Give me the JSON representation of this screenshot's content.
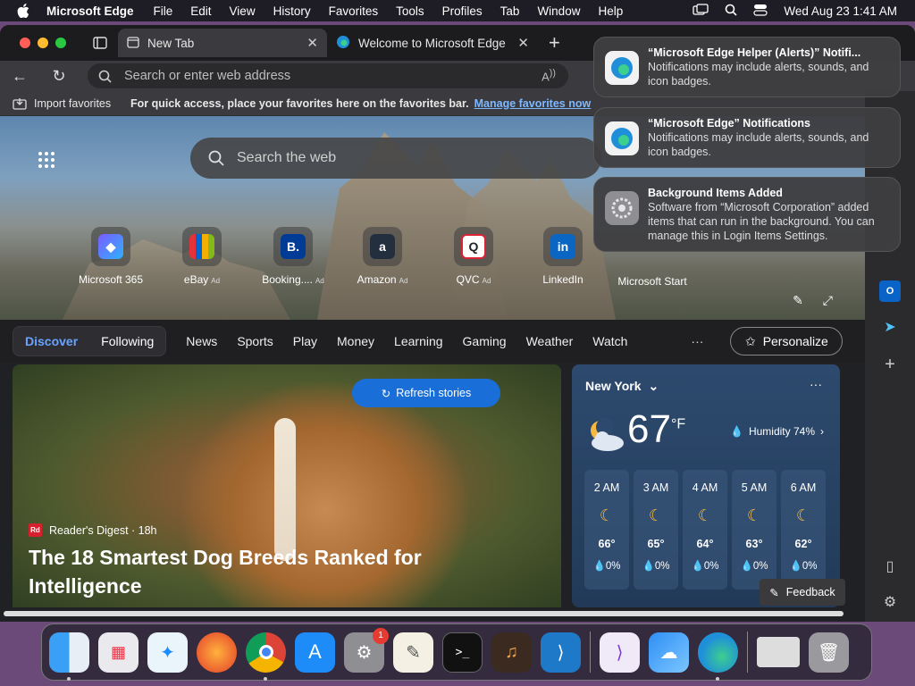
{
  "menubar": {
    "app": "Microsoft Edge",
    "items": [
      "File",
      "Edit",
      "View",
      "History",
      "Favorites",
      "Tools",
      "Profiles",
      "Tab",
      "Window",
      "Help"
    ],
    "clock": "Wed Aug 23  1:41 AM"
  },
  "tabs": [
    {
      "label": "New Tab"
    },
    {
      "label": "Welcome to Microsoft Edge"
    }
  ],
  "address": {
    "placeholder": "Search or enter web address"
  },
  "favbar": {
    "import": "Import favorites",
    "hint": "For quick access, place your favorites here on the favorites bar.",
    "link": "Manage favorites now"
  },
  "hero": {
    "search_placeholder": "Search the web"
  },
  "quicklinks": [
    {
      "label": "Microsoft 365",
      "ad": ""
    },
    {
      "label": "eBay",
      "ad": "Ad"
    },
    {
      "label": "Booking....",
      "ad": "Ad"
    },
    {
      "label": "Amazon",
      "ad": "Ad"
    },
    {
      "label": "QVC",
      "ad": "Ad"
    },
    {
      "label": "LinkedIn",
      "ad": ""
    },
    {
      "label": "Microsoft Start",
      "ad": ""
    }
  ],
  "feed": {
    "discover": "Discover",
    "following": "Following",
    "tabs": [
      "News",
      "Sports",
      "Play",
      "Money",
      "Learning",
      "Gaming",
      "Weather",
      "Watch"
    ],
    "more": "···",
    "personalize": "Personalize"
  },
  "story": {
    "refresh": "Refresh stories",
    "source": "Reader's Digest · 18h",
    "headline": "The 18 Smartest Dog Breeds Ranked for Intelligence"
  },
  "weather": {
    "city": "New York",
    "temp": "67",
    "unit": "°F",
    "humidity": "Humidity 74%",
    "hours": [
      {
        "time": "2 AM",
        "temp": "66°",
        "precip": "0%"
      },
      {
        "time": "3 AM",
        "temp": "65°",
        "precip": "0%"
      },
      {
        "time": "4 AM",
        "temp": "64°",
        "precip": "0%"
      },
      {
        "time": "5 AM",
        "temp": "63°",
        "precip": "0%"
      },
      {
        "time": "6 AM",
        "temp": "62°",
        "precip": "0%"
      }
    ]
  },
  "feedback": "Feedback",
  "notifications": [
    {
      "title": "“Microsoft Edge Helper (Alerts)” Notifi...",
      "body": "Notifications may include alerts, sounds, and icon badges."
    },
    {
      "title": "“Microsoft Edge” Notifications",
      "body": "Notifications may include alerts, sounds, and icon badges."
    },
    {
      "title": "Background Items Added",
      "body": "Software from “Microsoft Corporation” added items that can run in the background. You can manage this in Login Items Settings."
    }
  ],
  "dock": {
    "settings_badge": "1"
  },
  "colors": {
    "accent": "#1a6ed8",
    "discover": "#6aa3ff"
  }
}
